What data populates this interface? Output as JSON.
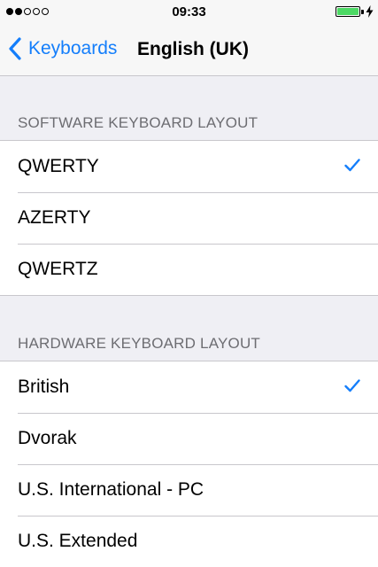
{
  "status_bar": {
    "signal_bars_filled": 2,
    "signal_bars_total": 5,
    "time": "09:33",
    "battery_level": 1.0,
    "charging": true
  },
  "nav": {
    "back_label": "Keyboards",
    "title": "English (UK)"
  },
  "software_section": {
    "header": "SOFTWARE KEYBOARD LAYOUT",
    "items": [
      {
        "label": "QWERTY",
        "selected": true
      },
      {
        "label": "AZERTY",
        "selected": false
      },
      {
        "label": "QWERTZ",
        "selected": false
      }
    ]
  },
  "hardware_section": {
    "header": "HARDWARE KEYBOARD LAYOUT",
    "items": [
      {
        "label": "British",
        "selected": true
      },
      {
        "label": "Dvorak",
        "selected": false
      },
      {
        "label": "U.S. International - PC",
        "selected": false
      },
      {
        "label": "U.S. Extended",
        "selected": false
      }
    ]
  },
  "colors": {
    "accent": "#147efb",
    "background": "#efeff4",
    "separator": "#c8c7cc",
    "section_header": "#6d6d72",
    "battery": "#4cd964"
  },
  "icons": {
    "back": "chevron-left-icon",
    "selected": "checkmark-icon",
    "charging": "bolt-icon"
  }
}
